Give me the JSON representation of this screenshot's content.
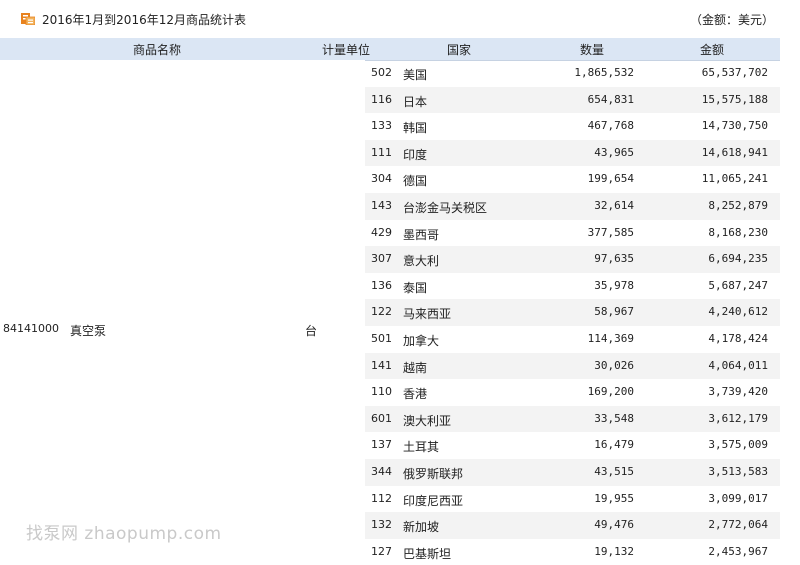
{
  "title": "2016年1月到2016年12月商品统计表",
  "unit_note": "（金额：美元）",
  "headers": {
    "product_name": "商品名称",
    "unit": "计量单位",
    "country": "国家",
    "quantity": "数量",
    "amount": "金额"
  },
  "product": {
    "code": "84141000",
    "name": "真空泵",
    "unit": "台"
  },
  "rows": [
    {
      "code": "502",
      "country": "美国",
      "quantity": "1,865,532",
      "amount": "65,537,702"
    },
    {
      "code": "116",
      "country": "日本",
      "quantity": "654,831",
      "amount": "15,575,188"
    },
    {
      "code": "133",
      "country": "韩国",
      "quantity": "467,768",
      "amount": "14,730,750"
    },
    {
      "code": "111",
      "country": "印度",
      "quantity": "43,965",
      "amount": "14,618,941"
    },
    {
      "code": "304",
      "country": "德国",
      "quantity": "199,654",
      "amount": "11,065,241"
    },
    {
      "code": "143",
      "country": "台澎金马关税区",
      "quantity": "32,614",
      "amount": "8,252,879"
    },
    {
      "code": "429",
      "country": "墨西哥",
      "quantity": "377,585",
      "amount": "8,168,230"
    },
    {
      "code": "307",
      "country": "意大利",
      "quantity": "97,635",
      "amount": "6,694,235"
    },
    {
      "code": "136",
      "country": "泰国",
      "quantity": "35,978",
      "amount": "5,687,247"
    },
    {
      "code": "122",
      "country": "马来西亚",
      "quantity": "58,967",
      "amount": "4,240,612"
    },
    {
      "code": "501",
      "country": "加拿大",
      "quantity": "114,369",
      "amount": "4,178,424"
    },
    {
      "code": "141",
      "country": "越南",
      "quantity": "30,026",
      "amount": "4,064,011"
    },
    {
      "code": "110",
      "country": "香港",
      "quantity": "169,200",
      "amount": "3,739,420"
    },
    {
      "code": "601",
      "country": "澳大利亚",
      "quantity": "33,548",
      "amount": "3,612,179"
    },
    {
      "code": "137",
      "country": "土耳其",
      "quantity": "16,479",
      "amount": "3,575,009"
    },
    {
      "code": "344",
      "country": "俄罗斯联邦",
      "quantity": "43,515",
      "amount": "3,513,583"
    },
    {
      "code": "112",
      "country": "印度尼西亚",
      "quantity": "19,955",
      "amount": "3,099,017"
    },
    {
      "code": "132",
      "country": "新加坡",
      "quantity": "49,476",
      "amount": "2,772,064"
    },
    {
      "code": "127",
      "country": "巴基斯坦",
      "quantity": "19,132",
      "amount": "2,453,967"
    }
  ],
  "watermark": "找泵网 zhaopump.com",
  "icon": "table-icon",
  "colors": {
    "header_bg": "#dbe6f4",
    "alt_row_bg": "#f3f3f3",
    "icon_orange": "#e8821e"
  }
}
